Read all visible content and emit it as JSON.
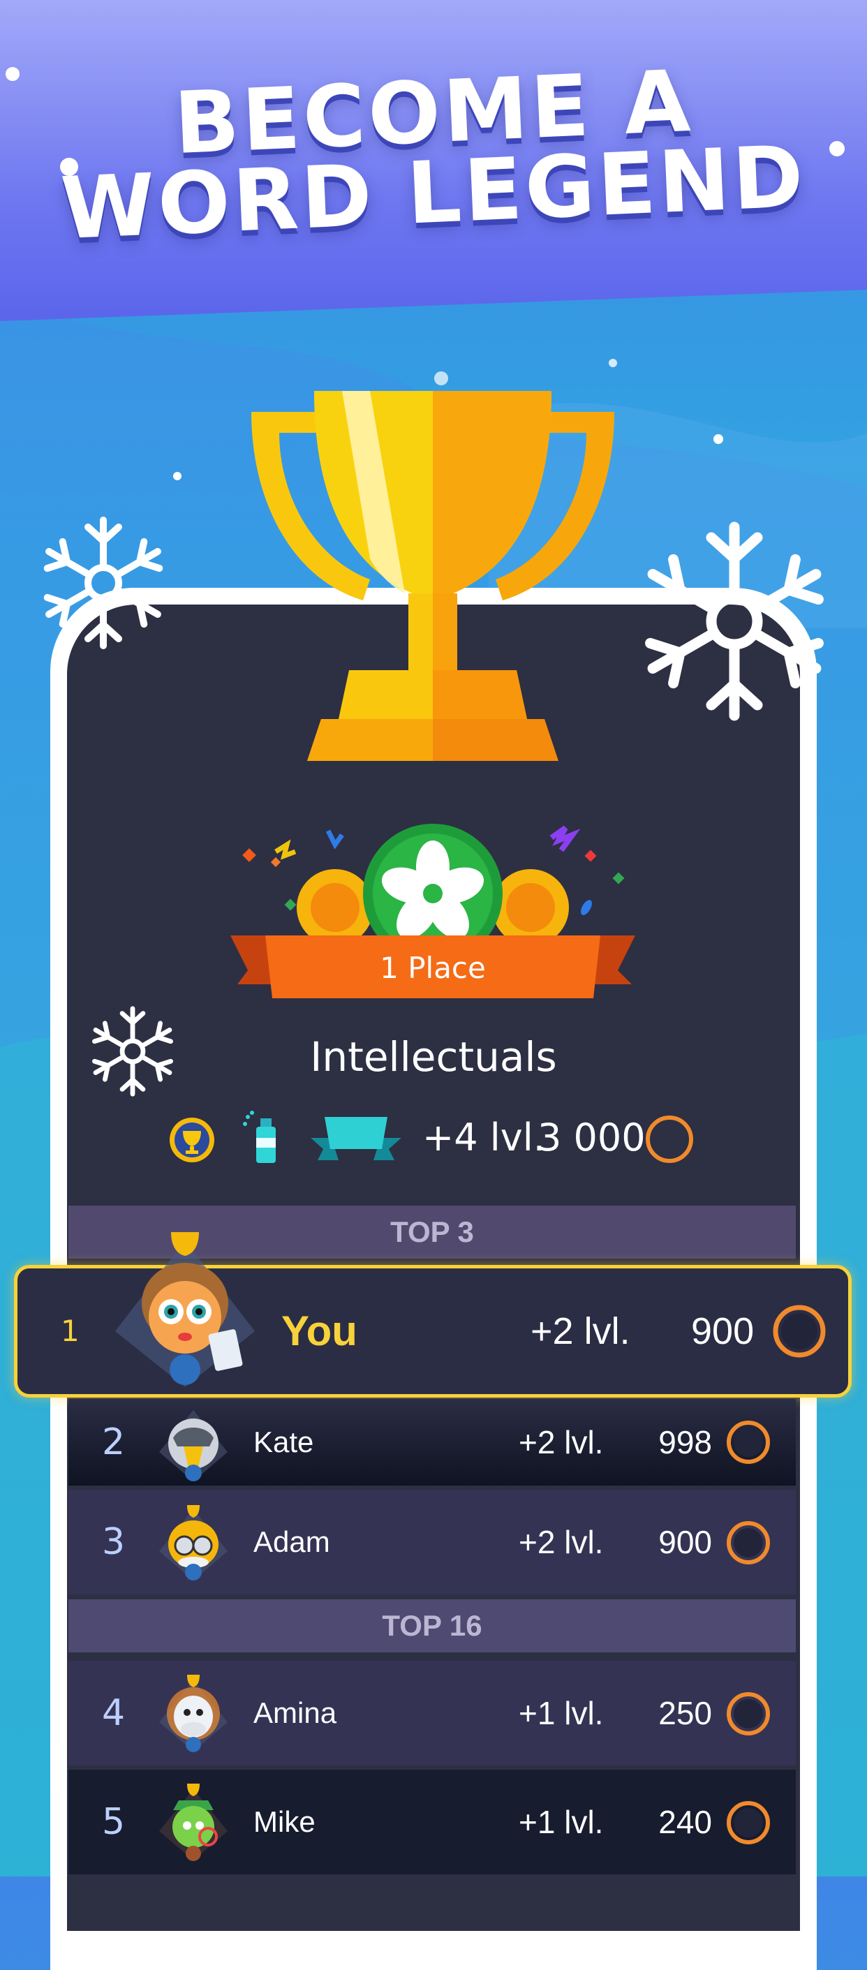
{
  "headline": {
    "line1": "BECOME A",
    "line2": "WORD LEGEND"
  },
  "award": {
    "place_label": "1 Place",
    "group_name": "Intellectuals"
  },
  "rewards": {
    "level": "+4 lvl.",
    "coins": "3 000"
  },
  "sections": {
    "top3": "TOP 3",
    "top16": "TOP 16"
  },
  "you": {
    "rank": "1",
    "name": "You",
    "level": "+2 lvl.",
    "score": "900"
  },
  "players": [
    {
      "rank": "2",
      "name": "Kate",
      "level": "+2 lvl.",
      "score": "998"
    },
    {
      "rank": "3",
      "name": "Adam",
      "level": "+2 lvl.",
      "score": "900"
    },
    {
      "rank": "4",
      "name": "Amina",
      "level": "+1 lvl.",
      "score": "250"
    },
    {
      "rank": "5",
      "name": "Mike",
      "level": "+1 lvl.",
      "score": "240"
    }
  ],
  "colors": {
    "accent_gold": "#f7d23a",
    "coin_orange": "#f08a2c",
    "screen_bg": "#2d2f43"
  },
  "icons": [
    "snowflake-icon",
    "trophy-icon",
    "cup-medal-icon",
    "spray-icon",
    "ribbon-icon",
    "coin-icon",
    "flower-badge-icon"
  ]
}
